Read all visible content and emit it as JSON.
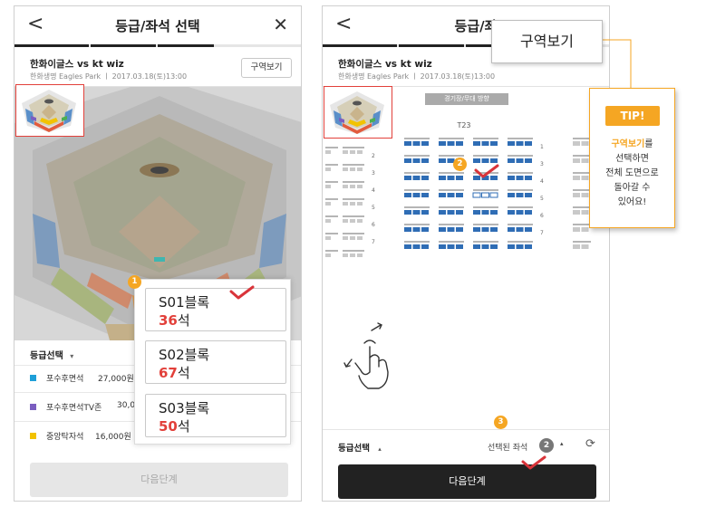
{
  "screen_a": {
    "title": "등급/좌석 선택",
    "back_glyph": "<",
    "close_glyph": "✕",
    "match_title": "한화이글스 vs kt wiz",
    "match_subtitle": "한화생명 Eagles Park ㅣ 2017.03.18(토)13:00",
    "zone_view_label": "구역보기",
    "grade_title": "등급선택",
    "grade_caret": "▾",
    "grades": [
      {
        "name": "포수후면석",
        "price": "27,000원",
        "color": "#1e9fd8"
      },
      {
        "name": "포수후면석TV존",
        "price": "30,0",
        "color": "#7b5ec0"
      },
      {
        "name": "중앙탁자석",
        "price": "16,000원",
        "color": "#f2c200"
      }
    ],
    "blocks": [
      {
        "name": "S01블록",
        "count": "36",
        "unit": "석"
      },
      {
        "name": "S02블록",
        "count": "67",
        "unit": "석"
      },
      {
        "name": "S03블록",
        "count": "50",
        "unit": "석"
      }
    ],
    "step_badge": "1",
    "next_label": "다음단계"
  },
  "screen_b": {
    "title": "등급/좌",
    "back_glyph": "<",
    "match_title": "한화이글스 vs kt wiz",
    "match_subtitle": "한화생명 Eagles Park ㅣ 2017.03.18(토)13:00",
    "stage_label": "경기장/무대 방향",
    "section_label": "T23",
    "row_numbers": [
      "1",
      "2",
      "3",
      "4",
      "5",
      "6",
      "7"
    ],
    "step_badge_2": "2",
    "step_badge_3": "3",
    "grade_title": "등급선택",
    "grade_caret": "▴",
    "selected_label": "선택된 좌석",
    "selected_count": "2",
    "selected_caret": "▴",
    "refresh_glyph": "⟳",
    "next_label": "다음단계"
  },
  "callout": {
    "label": "구역보기"
  },
  "tip": {
    "badge": "TIP!",
    "highlight": "구역보기",
    "line1_suffix": "를",
    "line2": "선택하면",
    "line3": "전체 도면으로",
    "line4": "돌아갈 수",
    "line5": "있어요!"
  },
  "colors": {
    "accent_orange": "#f5a623",
    "check_red": "#d9343a",
    "seat_blue": "#2f6db5",
    "seat_gray": "#c9c9c9"
  }
}
